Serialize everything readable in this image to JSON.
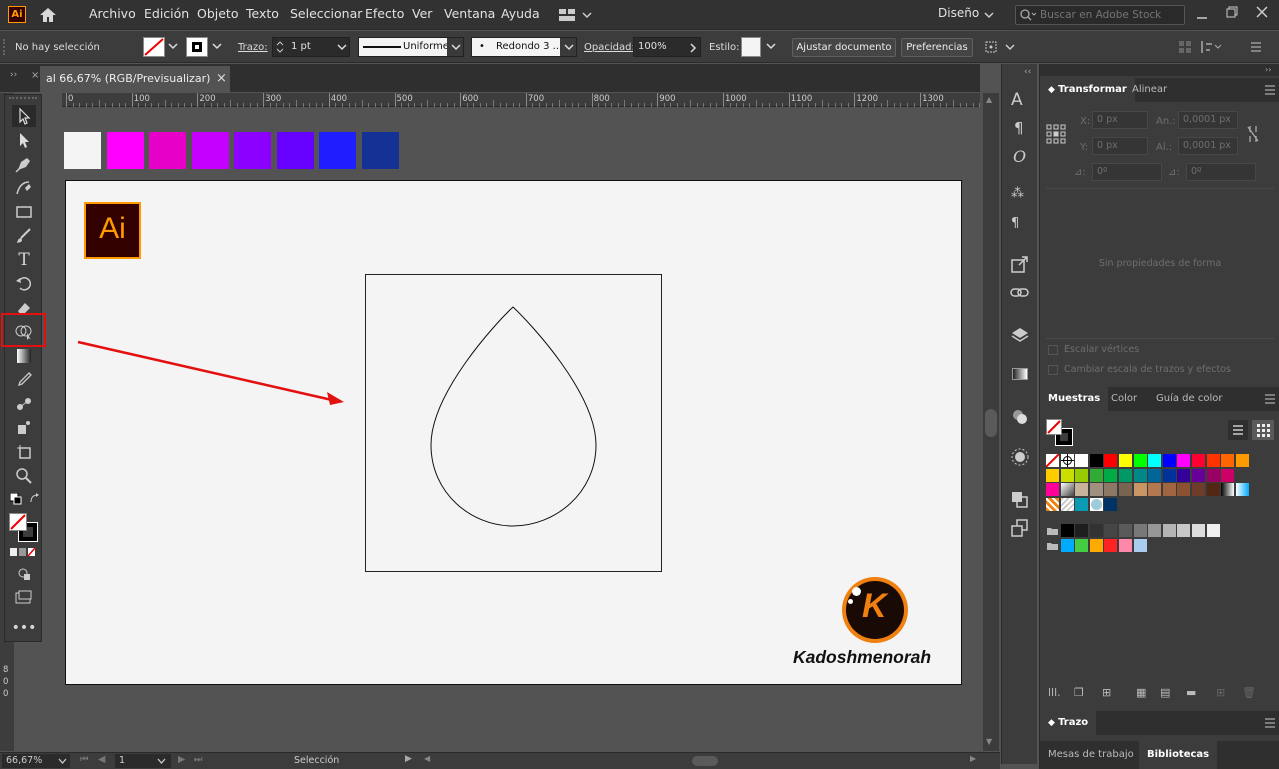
{
  "app": {
    "logo_text": "Ai",
    "workspace": "Diseño",
    "search_placeholder": "Buscar en Adobe Stock"
  },
  "menu": [
    "Archivo",
    "Edición",
    "Objeto",
    "Texto",
    "Seleccionar",
    "Efecto",
    "Ver",
    "Ventana",
    "Ayuda"
  ],
  "control": {
    "selection": "No hay selección",
    "stroke_label": "Trazo:",
    "stroke_weight": "1 pt",
    "stroke_profile": "Uniforme",
    "brush": "Redondo 3 ...",
    "opacity_label": "Opacidad:",
    "opacity_value": "100%",
    "style_label": "Estilo:",
    "adjust_button": "Ajustar documento",
    "prefs_button": "Preferencias"
  },
  "document": {
    "tab_title": "al 66,67% (RGB/Previsualizar)"
  },
  "ruler": {
    "h_ticks": [
      "0",
      "100",
      "200",
      "300",
      "400",
      "500",
      "600",
      "700",
      "800",
      "900",
      "1000",
      "1100",
      "1200",
      "1300"
    ],
    "v_ticks": [
      "8",
      "0",
      "0"
    ]
  },
  "palette": [
    "#f4f4f4",
    "#ff00ff",
    "#e600c8",
    "#c400ff",
    "#8c00ff",
    "#6600ff",
    "#1e1eff",
    "#143296"
  ],
  "artboard": {
    "logo_text": "Ai",
    "brand_letter": "K",
    "brand_name": "Kadoshmenorah"
  },
  "transform": {
    "tabs": [
      "Transformar",
      "Alinear"
    ],
    "x_label": "X:",
    "x_value": "0 px",
    "y_label": "Y:",
    "y_value": "0 px",
    "w_label": "An.:",
    "w_value": "0,0001 px",
    "h_label": "Al.:",
    "h_value": "0,0001 px",
    "rot_value": "0º",
    "shear_value": "0º",
    "empty_msg": "Sin propiedades de forma",
    "check_corners": "Escalar vértices",
    "check_strokes": "Cambiar escala de trazos y efectos"
  },
  "swatches_panel": {
    "tabs": [
      "Muestras",
      "Color",
      "Guía de color"
    ],
    "rows": [
      [
        "none",
        "reg",
        "#ffffff",
        "#000000",
        "#ff0000",
        "#ffff00",
        "#00ff00",
        "#00ffff",
        "#0000ff",
        "#ff00ff",
        "#ff0033",
        "#ff3300",
        "#ff6600",
        "#ff9900"
      ],
      [
        "#ffcc00",
        "#ccdd00",
        "#99cc00",
        "#33aa33",
        "#00aa44",
        "#009966",
        "#008888",
        "#006699",
        "#003399",
        "#330099",
        "#660099",
        "#990066",
        "#cc0066"
      ],
      [
        "#ff0099",
        "grad",
        "#c8b49b",
        "#a09080",
        "#8c7864",
        "#786450",
        "#c89664",
        "#b47850",
        "#a06440",
        "#8c5032",
        "#6e3c28",
        "#502814",
        "grad2",
        "grad3"
      ],
      [
        "pat",
        "pat2",
        "#0a9ab4",
        "pat3",
        "#003264"
      ],
      [
        "folder",
        "#000000",
        "#1e1e1e",
        "#323232",
        "#464646",
        "#5a5a5a",
        "#787878",
        "#969696",
        "#b4b4b4",
        "#c8c8c8",
        "#dcdcdc",
        "#f0f0f0"
      ],
      [
        "folder",
        "#00aaff",
        "#44cc44",
        "#ffaa00",
        "#ff2222",
        "#ff88aa",
        "#aaccee"
      ]
    ]
  },
  "stroke_panel": {
    "title": "Trazo"
  },
  "bottom_tabs": [
    "Mesas de trabajo",
    "Bibliotecas"
  ],
  "status": {
    "zoom": "66,67%",
    "artboard_num": "1",
    "tool": "Selección"
  }
}
